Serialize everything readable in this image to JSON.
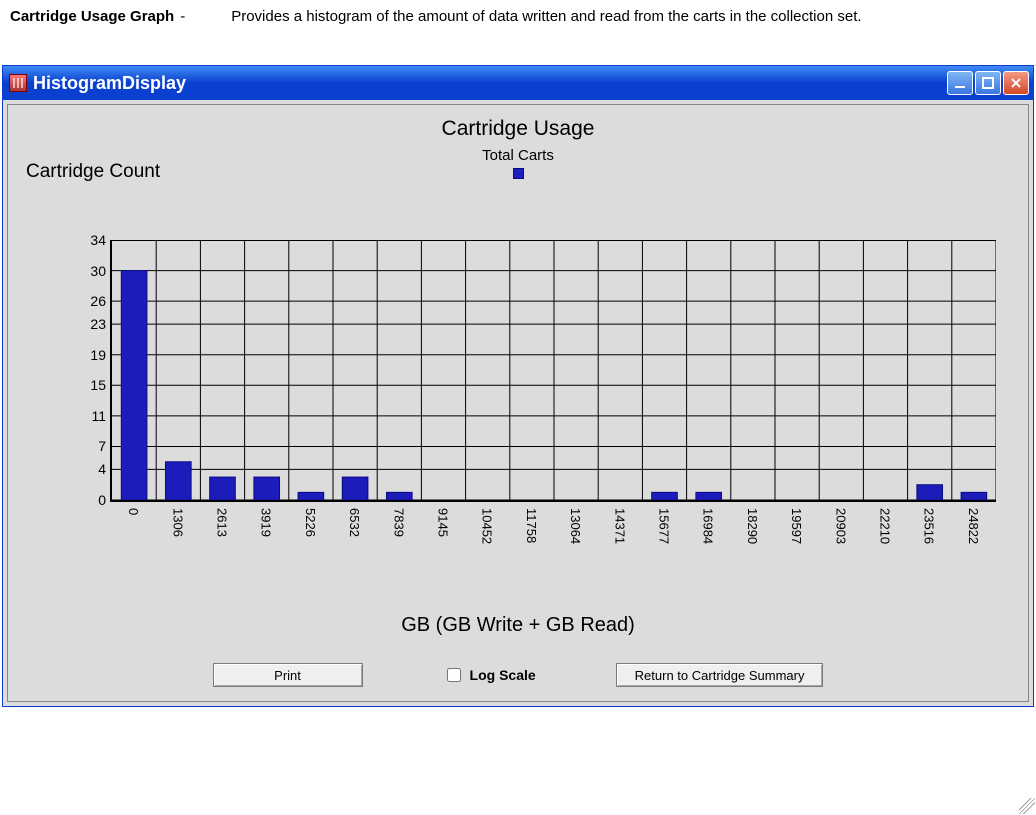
{
  "doc": {
    "term": "Cartridge Usage Graph",
    "dash": "-",
    "desc": "Provides a histogram of the amount of data written and read from the carts in the collection set."
  },
  "window": {
    "title": "HistogramDisplay"
  },
  "chart_data": {
    "type": "bar",
    "title": "Cartridge Usage",
    "legend": "Total Carts",
    "ylabel": "Cartridge Count",
    "xlabel": "GB (GB Write + GB Read)",
    "ylim": [
      0,
      34
    ],
    "yticks": [
      0,
      4,
      7,
      11,
      15,
      19,
      23,
      26,
      30,
      34
    ],
    "categories": [
      "0",
      "1306",
      "2613",
      "3919",
      "5226",
      "6532",
      "7839",
      "9145",
      "10452",
      "11758",
      "13064",
      "14371",
      "15677",
      "16984",
      "18290",
      "19597",
      "20903",
      "22210",
      "23516",
      "24822"
    ],
    "values": [
      30,
      5,
      3,
      3,
      1,
      3,
      1,
      0,
      0,
      0,
      0,
      0,
      1,
      1,
      0,
      0,
      0,
      0,
      2,
      1
    ]
  },
  "toolbar": {
    "print_label": "Print",
    "logscale_label": "Log Scale",
    "logscale_checked": false,
    "return_label": "Return to Cartridge Summary"
  },
  "colors": {
    "bar": "#1c1cbb",
    "titlebar_top": "#3f8cf3",
    "titlebar_bottom": "#0a3fcf",
    "panel": "#dcdcdc"
  }
}
